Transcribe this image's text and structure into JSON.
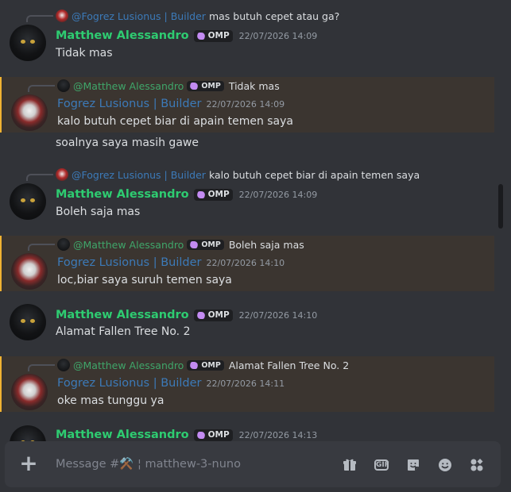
{
  "messages": [
    {
      "reply": {
        "author": "@Fogrez Lusionus | Builder",
        "text": "mas butuh cepet atau ga?"
      },
      "author": "Matthew Alessandro",
      "tag": "OMP",
      "time": "22/07/2026 14:09",
      "lines": [
        "Tidak mas"
      ]
    },
    {
      "reply": {
        "author": "@Matthew Alessandro",
        "tag": "OMP",
        "text": "Tidak mas"
      },
      "author": "Fogrez Lusionus | Builder",
      "time": "22/07/2026 14:09",
      "lines": [
        "kalo butuh cepet biar di apain temen saya",
        "soalnya saya masih gawe"
      ]
    },
    {
      "reply": {
        "author": "@Fogrez Lusionus | Builder",
        "text": "kalo butuh cepet biar di apain temen saya"
      },
      "author": "Matthew Alessandro",
      "tag": "OMP",
      "time": "22/07/2026 14:09",
      "lines": [
        "Boleh saja mas"
      ]
    },
    {
      "reply": {
        "author": "@Matthew Alessandro",
        "tag": "OMP",
        "text": "Boleh saja mas"
      },
      "author": "Fogrez Lusionus | Builder",
      "time": "22/07/2026 14:10",
      "lines": [
        "loc,biar saya suruh temen saya"
      ]
    },
    {
      "author": "Matthew Alessandro",
      "tag": "OMP",
      "time": "22/07/2026 14:10",
      "lines": [
        "Alamat Fallen Tree No. 2"
      ]
    },
    {
      "reply": {
        "author": "@Matthew Alessandro",
        "tag": "OMP",
        "text": "Alamat Fallen Tree No. 2"
      },
      "author": "Fogrez Lusionus | Builder",
      "time": "22/07/2026 14:11",
      "lines": [
        "oke mas tunggu ya"
      ]
    },
    {
      "author": "Matthew Alessandro",
      "tag": "OMP",
      "time": "22/07/2026 14:13",
      "lines": []
    }
  ],
  "composer": {
    "placeholder": "Message #⚒️ ¦ matthew-3-nuno",
    "gif_label": "GIF"
  },
  "colors": {
    "highlight": "#3b3530",
    "mention_bar": "#f0b232",
    "green_name": "#2ecc71",
    "blue_name": "#3c7ab8"
  },
  "icons": [
    "plus-icon",
    "gift-icon",
    "gif-icon",
    "sticker-icon",
    "emoji-icon",
    "apps-icon"
  ]
}
